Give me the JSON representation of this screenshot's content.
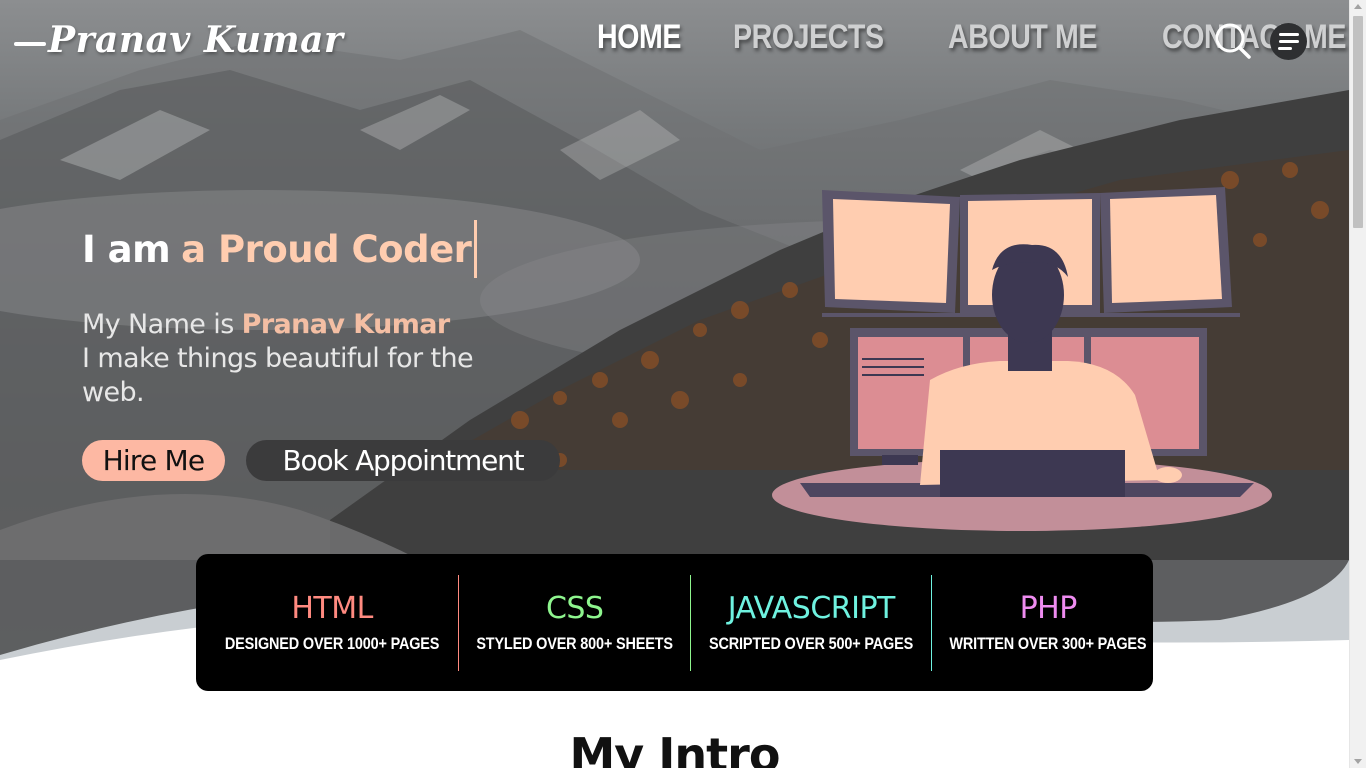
{
  "header": {
    "logo": "Pranav Kumar",
    "nav": [
      {
        "label": "HOME",
        "active": true
      },
      {
        "label": "PROJECTS",
        "active": false
      },
      {
        "label": "ABOUT ME",
        "active": false
      },
      {
        "label": "CONTACT ME",
        "active": false
      }
    ],
    "search_icon": "search-icon",
    "menu_icon": "menu-icon"
  },
  "hero": {
    "headline_prefix": "I am",
    "headline_typed": "a Proud Coder",
    "intro_prefix": "My Name is ",
    "intro_name": "Pranav Kumar",
    "intro_rest": "I make things beautiful for the web.",
    "hire_button": "Hire Me",
    "book_button": "Book Appointment",
    "accent_color": "#ffcdb0"
  },
  "skills": [
    {
      "title": "HTML",
      "desc": "DESIGNED OVER 1000+ PAGES",
      "color": "#ff8a80"
    },
    {
      "title": "CSS",
      "desc": "STYLED OVER 800+ SHEETS",
      "color": "#8ef58e"
    },
    {
      "title": "JAVASCRIPT",
      "desc": "SCRIPTED OVER 500+ PAGES",
      "color": "#6ff2e0"
    },
    {
      "title": "PHP",
      "desc": "WRITTEN OVER 300+ PAGES",
      "color": "#ee8cf0"
    }
  ],
  "intro_section": {
    "title": "My Intro"
  }
}
